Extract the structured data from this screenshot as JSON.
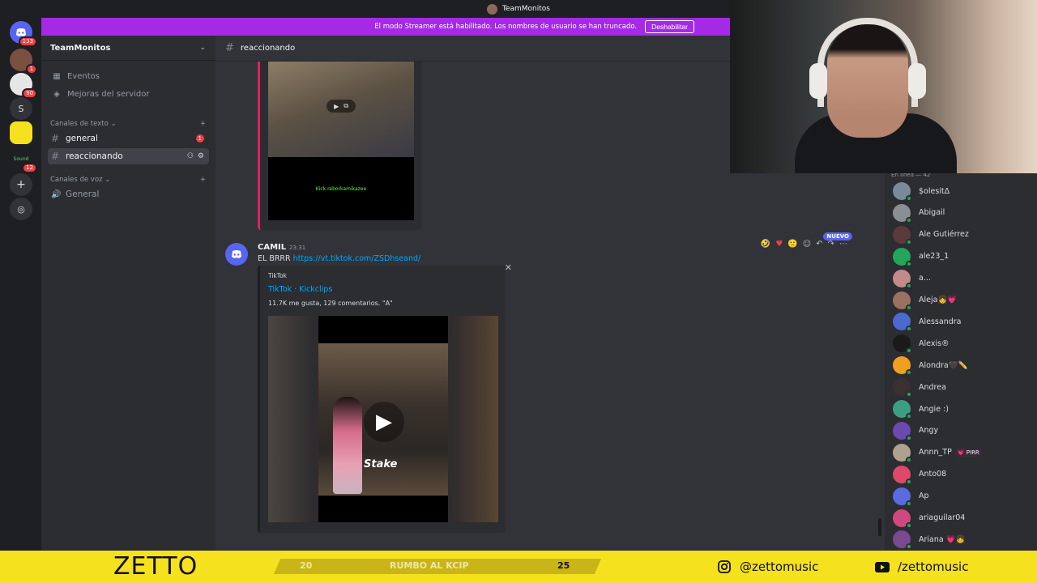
{
  "window": {
    "title": "TeamMonitos"
  },
  "streamer_banner": {
    "text": "El modo Streamer está habilitado. Los nombres de usuario se han truncado.",
    "button": "Deshabilitar"
  },
  "servers": [
    {
      "label": "",
      "badge": "133"
    },
    {
      "label": "",
      "badge": "1"
    },
    {
      "label": "",
      "badge": "90"
    },
    {
      "label": "S",
      "badge": ""
    },
    {
      "label": "",
      "badge": ""
    },
    {
      "label": "Sound",
      "badge": "12"
    }
  ],
  "sidebar": {
    "server_name": "TeamMonitos",
    "items": [
      {
        "label": "Eventos"
      },
      {
        "label": "Mejoras del servidor"
      }
    ],
    "text_category": "Canales de texto",
    "text_channels": [
      {
        "label": "general",
        "badge": "1"
      },
      {
        "label": "reaccionando"
      }
    ],
    "voice_category": "Canales de voz",
    "voice_channels": [
      {
        "label": "General"
      }
    ]
  },
  "channel": {
    "name": "reaccionando"
  },
  "previous_embed": {
    "overlay_text": "Kick.reborkamikazee"
  },
  "message": {
    "author": "CAMIL",
    "time": "23:31",
    "text": "EL BRRR",
    "link": "https://vt.tiktok.com/ZSDhseand/",
    "new_badge": "NUEVO",
    "embed": {
      "provider": "TikTok",
      "title": "TikTok · Kickclips",
      "description": "11.7K me gusta, 129 comentarios. \"A\"",
      "brand_text": "Stake"
    }
  },
  "members": {
    "header": "En línea — 42",
    "list": [
      {
        "name": "$olesitΔ",
        "color": "#7a8a9a"
      },
      {
        "name": "Abigail",
        "color": "#8a8f96"
      },
      {
        "name": "Ale Gutiérrez",
        "color": "#5a3a3a"
      },
      {
        "name": "ale23_1",
        "color": "#23a55a"
      },
      {
        "name": "a...",
        "color": "#c28a8a"
      },
      {
        "name": "Aleja👧💗",
        "color": "#9a7060"
      },
      {
        "name": "Alessandra",
        "color": "#4a6ad0"
      },
      {
        "name": "Alexis®",
        "color": "#1a1a1a"
      },
      {
        "name": "Alondra🖤✏️",
        "color": "#f0a020"
      },
      {
        "name": "Andrea",
        "color": "#3a3030"
      },
      {
        "name": "Angie :)",
        "color": "#3aa080"
      },
      {
        "name": "Angy",
        "color": "#6a4ab0"
      },
      {
        "name": "Annn_TP",
        "color": "#b0a090",
        "tag": "💗 PIRR"
      },
      {
        "name": "Anto08",
        "color": "#e0486a"
      },
      {
        "name": "Ap",
        "color": "#5a6ae0"
      },
      {
        "name": "ariaguilar04",
        "color": "#d04880"
      },
      {
        "name": "Ariana 💗👧",
        "color": "#7a4a90"
      }
    ]
  },
  "stream_bar": {
    "brand": "ZETTO",
    "progress_start": "20",
    "progress_label": "RUMBO AL KCIP",
    "progress_end": "25",
    "progress_fraction": 0.0,
    "instagram": "@zettomusic",
    "youtube": "/zettomusic"
  },
  "colors": {
    "accent": "#5865f2",
    "banner": "#a42ae5",
    "link": "#00a8fc",
    "bar": "#f5e11d"
  }
}
